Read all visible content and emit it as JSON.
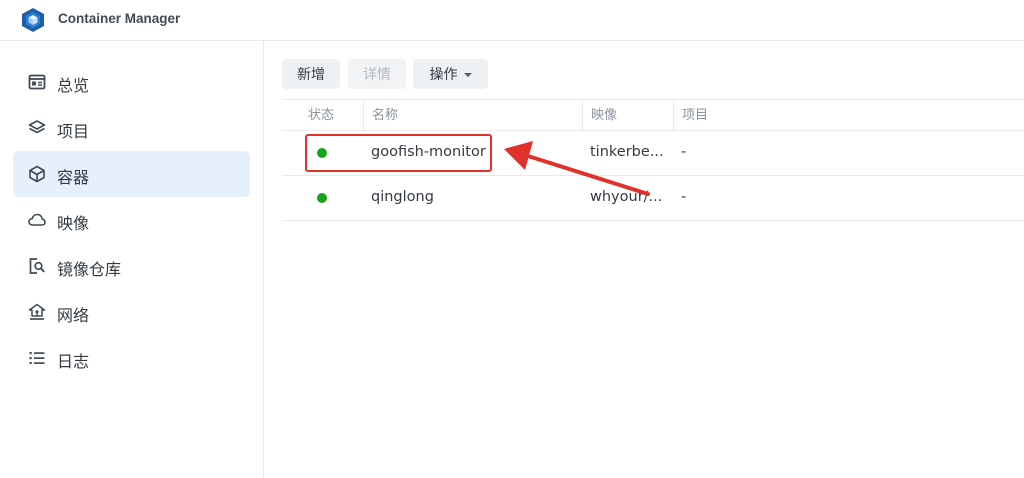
{
  "app": {
    "title": "Container Manager",
    "logo_icon": "cube-hexagon-logo",
    "logo_color": "#1e5fa8"
  },
  "sidebar": {
    "items": [
      {
        "label": "总览",
        "icon": "overview-icon",
        "active": false
      },
      {
        "label": "项目",
        "icon": "layers-icon",
        "active": false
      },
      {
        "label": "容器",
        "icon": "box-icon",
        "active": true
      },
      {
        "label": "映像",
        "icon": "cloud-icon",
        "active": false
      },
      {
        "label": "镜像仓库",
        "icon": "registry-search-icon",
        "active": false
      },
      {
        "label": "网络",
        "icon": "network-icon",
        "active": false
      },
      {
        "label": "日志",
        "icon": "list-icon",
        "active": false
      }
    ]
  },
  "toolbar": {
    "new_label": "新增",
    "details_label": "详情",
    "actions_label": "操作"
  },
  "table": {
    "columns": [
      "状态",
      "名称",
      "映像",
      "项目"
    ],
    "rows": [
      {
        "status": "running",
        "name": "goofish-monitor",
        "image": "tinkerbe...",
        "project": "-"
      },
      {
        "status": "running",
        "name": "qinglong",
        "image": "whyour/...",
        "project": "-"
      }
    ]
  },
  "colors": {
    "accent": "#e6f0fa",
    "running": "#1aa21a",
    "annotation": "#e0312b"
  }
}
